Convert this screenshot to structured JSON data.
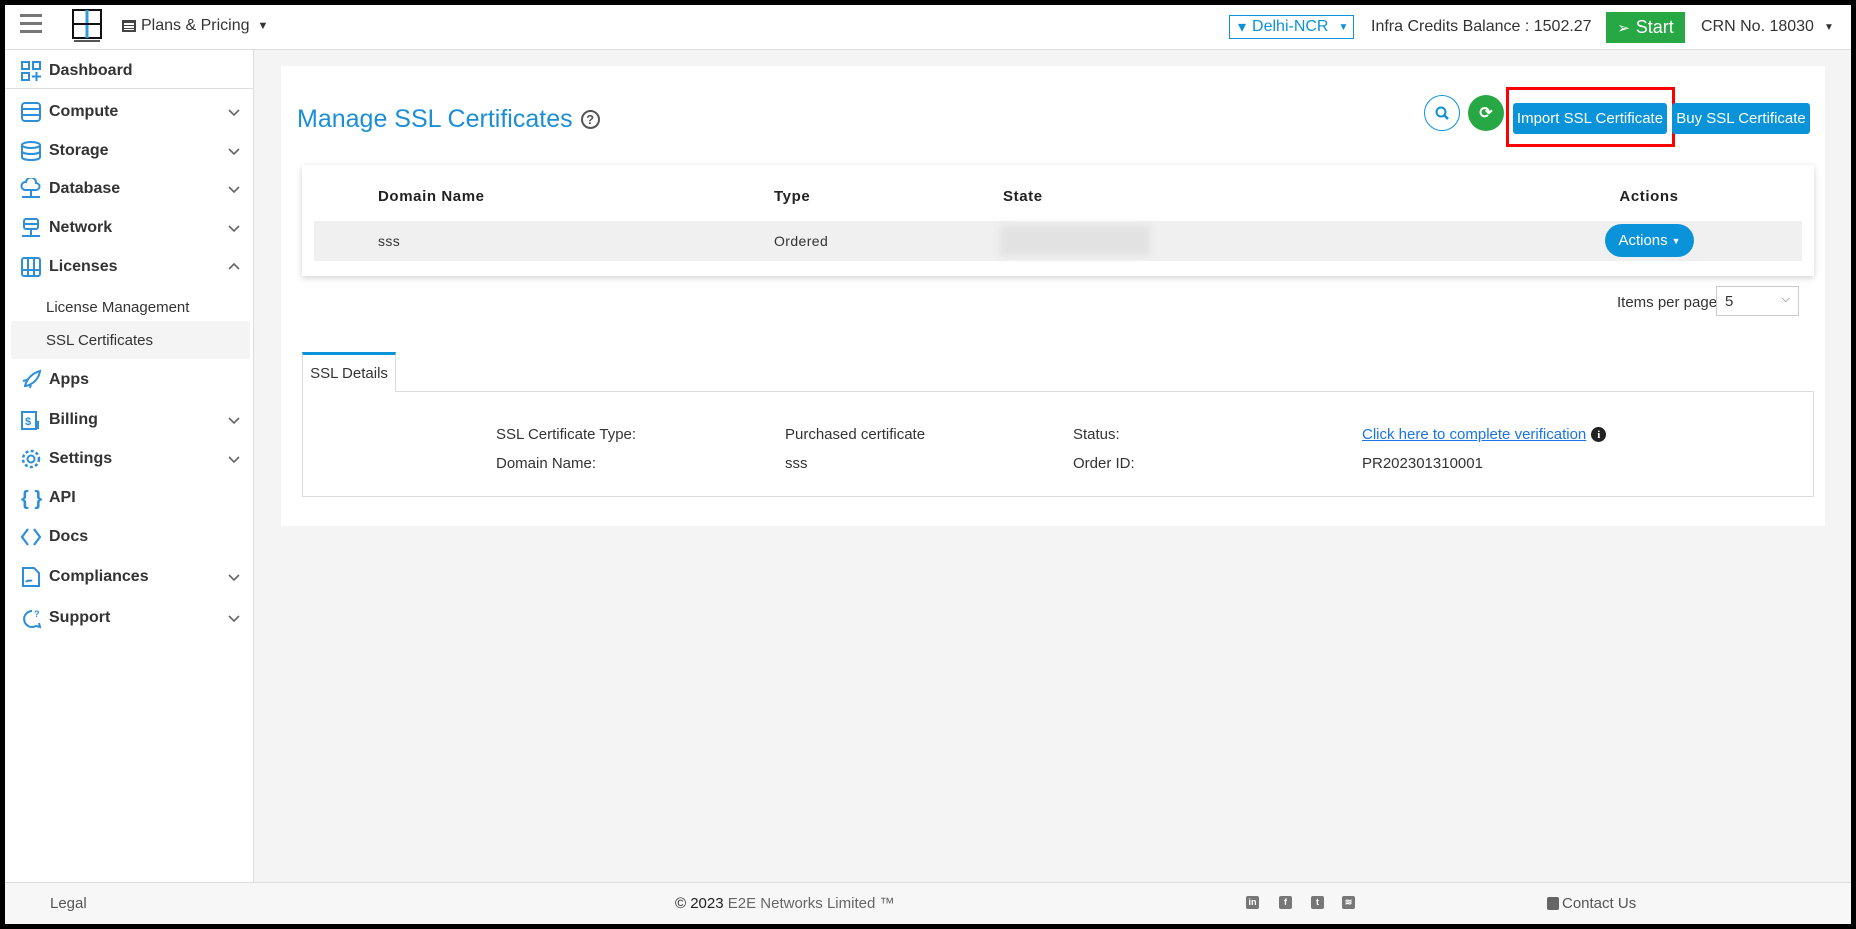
{
  "header": {
    "plans_label": "Plans & Pricing",
    "region": "Delhi-NCR",
    "credits": "Infra Credits Balance : 1502.27",
    "start_label": "Start",
    "crn": "CRN No. 18030",
    "logo_text": "E2E Networks"
  },
  "sidebar": {
    "items": [
      {
        "label": "Dashboard",
        "icon": "dashboard-icon"
      },
      {
        "label": "Compute",
        "icon": "server-icon",
        "chevron": "down"
      },
      {
        "label": "Storage",
        "icon": "database-icon",
        "chevron": "down"
      },
      {
        "label": "Database",
        "icon": "cloud-network-icon",
        "chevron": "down"
      },
      {
        "label": "Network",
        "icon": "network-icon",
        "chevron": "down"
      },
      {
        "label": "Licenses",
        "icon": "licenses-icon",
        "chevron": "up"
      },
      {
        "label": "Apps",
        "icon": "rocket-icon"
      },
      {
        "label": "Billing",
        "icon": "billing-icon",
        "chevron": "down"
      },
      {
        "label": "Settings",
        "icon": "gear-icon",
        "chevron": "down"
      },
      {
        "label": "API",
        "icon": "braces-icon"
      },
      {
        "label": "Docs",
        "icon": "code-icon"
      },
      {
        "label": "Compliances",
        "icon": "document-icon",
        "chevron": "down"
      },
      {
        "label": "Support",
        "icon": "support-icon",
        "chevron": "down"
      }
    ],
    "sub_items": [
      {
        "label": "License Management"
      },
      {
        "label": "SSL Certificates",
        "active": true
      }
    ]
  },
  "main": {
    "title": "Manage SSL Certificates",
    "import_label": "Import SSL Certificate",
    "buy_label": "Buy SSL Certificate",
    "table": {
      "columns": [
        "Domain Name",
        "Type",
        "State",
        "Actions"
      ],
      "rows": [
        {
          "domain": "sss",
          "type": "Ordered",
          "state": "",
          "action": "Actions"
        }
      ]
    },
    "items_per_page_label": "Items per page",
    "items_per_page": "5",
    "tab_label": "SSL Details",
    "details": {
      "cert_type_label": "SSL Certificate Type:",
      "cert_type": "Purchased certificate",
      "status_label": "Status:",
      "status_link": "Click here to complete verification",
      "domain_label": "Domain Name:",
      "domain": "sss",
      "order_label": "Order ID:",
      "order_id": "PR202301310001"
    }
  },
  "footer": {
    "legal": "Legal",
    "copyright": "© 2023",
    "company": "E2E Networks Limited ™",
    "contact": "Contact Us"
  },
  "colors": {
    "accent": "#0b93d9",
    "start": "#28a745",
    "highlight": "#ff0000"
  }
}
